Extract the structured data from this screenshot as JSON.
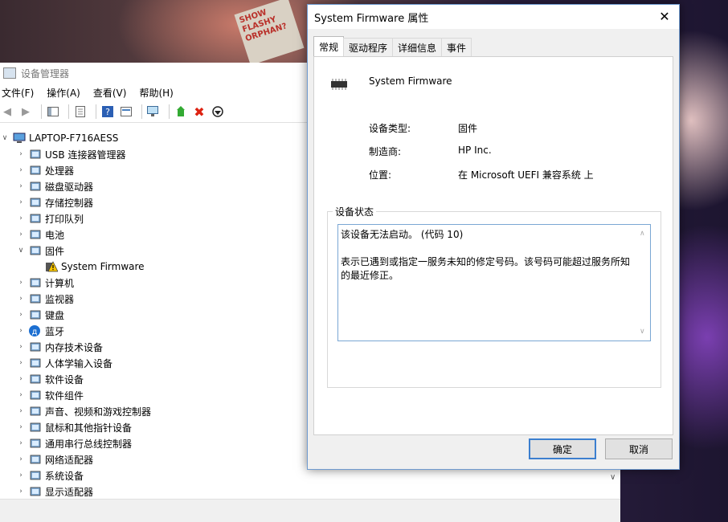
{
  "device_manager": {
    "title": "设备管理器",
    "menu": [
      "文件(F)",
      "操作(A)",
      "查看(V)",
      "帮助(H)"
    ],
    "root": "LAPTOP-F716AESS",
    "items": [
      {
        "label": "USB 连接器管理器",
        "icon": "usb-icon",
        "expanded": false
      },
      {
        "label": "处理器",
        "icon": "cpu-icon",
        "expanded": false
      },
      {
        "label": "磁盘驱动器",
        "icon": "disk-icon",
        "expanded": false
      },
      {
        "label": "存储控制器",
        "icon": "storage-controller-icon",
        "expanded": false
      },
      {
        "label": "打印队列",
        "icon": "printer-icon",
        "expanded": false
      },
      {
        "label": "电池",
        "icon": "battery-icon",
        "expanded": false
      },
      {
        "label": "固件",
        "icon": "firmware-icon",
        "expanded": true
      },
      {
        "label": "System Firmware",
        "icon": "warning-firmware-icon",
        "child": true
      },
      {
        "label": "计算机",
        "icon": "computer-icon",
        "expanded": false
      },
      {
        "label": "监视器",
        "icon": "monitor-icon",
        "expanded": false
      },
      {
        "label": "键盘",
        "icon": "keyboard-icon",
        "expanded": false
      },
      {
        "label": "蓝牙",
        "icon": "bluetooth-icon",
        "expanded": false
      },
      {
        "label": "内存技术设备",
        "icon": "memory-icon",
        "expanded": false
      },
      {
        "label": "人体学输入设备",
        "icon": "hid-icon",
        "expanded": false
      },
      {
        "label": "软件设备",
        "icon": "software-device-icon",
        "expanded": false
      },
      {
        "label": "软件组件",
        "icon": "software-component-icon",
        "expanded": false
      },
      {
        "label": "声音、视频和游戏控制器",
        "icon": "sound-icon",
        "expanded": false
      },
      {
        "label": "鼠标和其他指针设备",
        "icon": "mouse-icon",
        "expanded": false
      },
      {
        "label": "通用串行总线控制器",
        "icon": "usb-controller-icon",
        "expanded": false
      },
      {
        "label": "网络适配器",
        "icon": "network-icon",
        "expanded": false
      },
      {
        "label": "系统设备",
        "icon": "system-device-icon",
        "expanded": false
      },
      {
        "label": "显示适配器",
        "icon": "display-adapter-icon",
        "expanded": false
      }
    ]
  },
  "dialog": {
    "title": "System Firmware 属性",
    "tabs": [
      "常规",
      "驱动程序",
      "详细信息",
      "事件"
    ],
    "active_tab": "常规",
    "device_name": "System Firmware",
    "props": {
      "type_label": "设备类型:",
      "type_value": "固件",
      "mfr_label": "制造商:",
      "mfr_value": "HP Inc.",
      "loc_label": "位置:",
      "loc_value": "在 Microsoft UEFI 兼容系统 上"
    },
    "status_group": "设备状态",
    "status_line1": "该设备无法启动。 (代码 10)",
    "status_line2": "表示已遇到或指定一服务未知的修定号码。该号码可能超过服务所知的最近修正。",
    "ok": "确定",
    "cancel": "取消"
  },
  "wallpaper_text": "SHOW\nFLASHY\nORPHAN?"
}
